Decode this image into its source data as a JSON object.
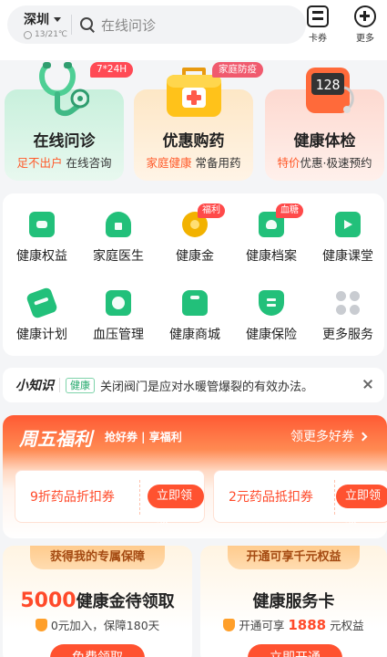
{
  "header": {
    "city": "深圳",
    "weather_temp": "13/21℃",
    "search_placeholder": "在线问诊",
    "coupon_label": "卡券",
    "more_label": "更多",
    "icons": {
      "location_caret": "chevron-down-icon",
      "weather": "sun-icon",
      "search": "search-icon",
      "coupon": "coupon-icon",
      "more": "plus-circle-icon"
    }
  },
  "service_cards": [
    {
      "title": "在线问诊",
      "tag": "7*24H",
      "sub_highlight": "足不出户",
      "sub_rest": "在线咨询",
      "icon": "stethoscope-icon"
    },
    {
      "title": "优惠购药",
      "tag": "家庭防疫",
      "sub_highlight": "家庭健康",
      "sub_rest": "常备用药",
      "icon": "medicine-box-icon"
    },
    {
      "title": "健康体检",
      "tag": "",
      "sub_highlight": "特价",
      "sub_rest": "优惠·极速预约",
      "icon": "scale-icon",
      "scale_reading": "128"
    }
  ],
  "grid": [
    {
      "label": "健康权益",
      "icon": "health-benefits-icon",
      "badge": ""
    },
    {
      "label": "家庭医生",
      "icon": "family-doctor-icon",
      "badge": ""
    },
    {
      "label": "健康金",
      "icon": "health-gold-icon",
      "badge": "福利"
    },
    {
      "label": "健康档案",
      "icon": "health-record-icon",
      "badge": "血糖"
    },
    {
      "label": "健康课堂",
      "icon": "health-class-icon",
      "badge": ""
    },
    {
      "label": "健康计划",
      "icon": "health-plan-icon",
      "badge": ""
    },
    {
      "label": "血压管理",
      "icon": "blood-pressure-icon",
      "badge": ""
    },
    {
      "label": "健康商城",
      "icon": "health-mall-icon",
      "badge": ""
    },
    {
      "label": "健康保险",
      "icon": "health-insurance-icon",
      "badge": ""
    },
    {
      "label": "更多服务",
      "icon": "more-services-icon",
      "badge": ""
    }
  ],
  "tip": {
    "title": "小知识",
    "chip": "健康",
    "text": "关闭阀门是应对水暖管爆裂的有效办法。"
  },
  "promo": {
    "title": "周五福利",
    "tagline": "抢好券 | 享福利",
    "more": "领更多好券",
    "coupons": [
      {
        "name": "9折药品折扣券",
        "button": "立即领取"
      },
      {
        "name": "2元药品抵扣券",
        "button": "立即领取"
      }
    ]
  },
  "bottom_cards": [
    {
      "header": "获得我的专属保障",
      "main_num": "5000",
      "main_text": "健康金待领取",
      "sub_pre": "0元加入，保障180天",
      "sub_num": "",
      "sub_post": "",
      "button": "免费领取"
    },
    {
      "header": "开通可享千元权益",
      "main_num": "",
      "main_text": "健康服务卡",
      "sub_pre": "开通可享",
      "sub_num": "1888",
      "sub_post": "元权益",
      "button": "立即开通"
    }
  ],
  "colors": {
    "accent_orange": "#ff5230",
    "green": "#22c07a",
    "gold": "#f2b200"
  }
}
